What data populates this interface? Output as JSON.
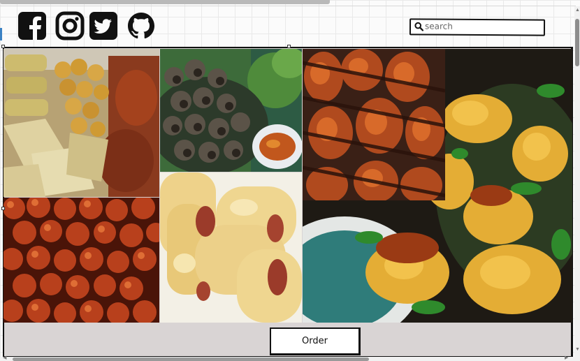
{
  "social": {
    "icons": [
      "facebook-icon",
      "instagram-icon",
      "twitter-icon",
      "github-icon"
    ]
  },
  "search": {
    "placeholder": "search",
    "value": ""
  },
  "gallery": {
    "photos": [
      "spring-rolls-and-puff-puff",
      "snails-with-sauce",
      "grilled-chicken",
      "shrimp-and-plantain",
      "fried-meatballs",
      "sausage-rolls"
    ]
  },
  "order_button": {
    "label": "Order"
  },
  "colors": {
    "border": "#111111",
    "gallery_bg": "#d9d4d4",
    "scroll_thumb": "#8d8d8d"
  }
}
